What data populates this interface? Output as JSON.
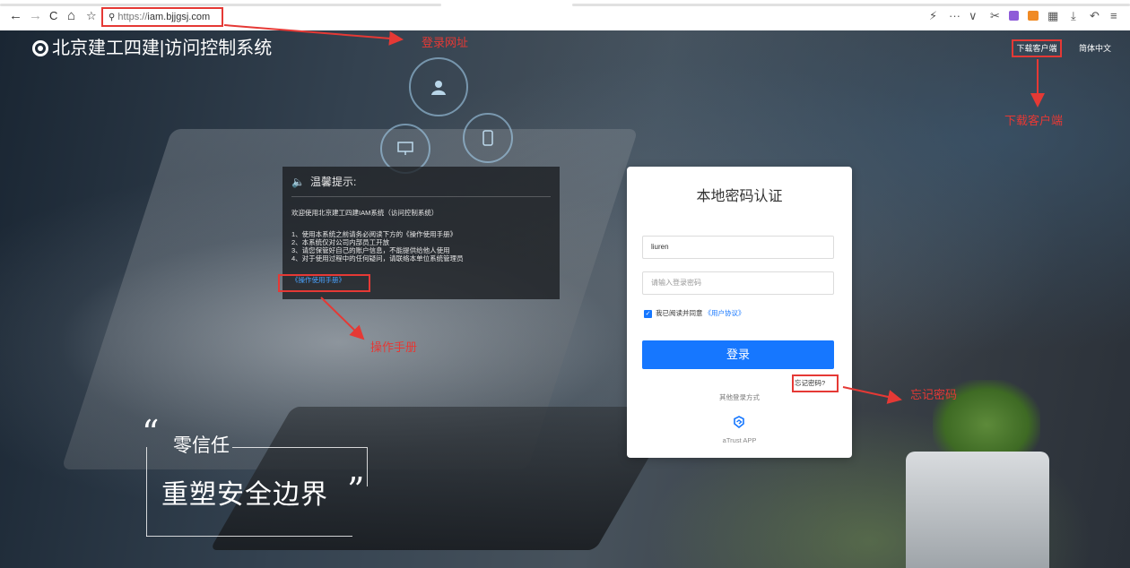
{
  "browser": {
    "nav": {
      "back": "←",
      "forward": "→",
      "reload": "C",
      "home": "⌂",
      "fav": "☆"
    },
    "address_prefix": "https://",
    "address_host": "iam.bjjgsj.com",
    "toolbar_glyphs": {
      "lightning": "⚡",
      "more": "···",
      "chevron": "∨",
      "scissors": "✂",
      "grid": "▦",
      "download": "⤓",
      "undo": "↶",
      "menu": "≡"
    }
  },
  "header": {
    "brand": "北京建工四建|访问控制系统",
    "download_client": "下载客户端",
    "language": "简体中文"
  },
  "notice": {
    "title": "温馨提示:",
    "welcome": "欢迎使用北京建工四建IAM系统（访问控制系统）",
    "items": [
      "1、使用本系统之前请务必阅读下方的《操作使用手册》",
      "2、本系统仅对公司内部员工开放",
      "3、请您保管好自己的账户信息，不能提供给他人使用",
      "4、对于使用过程中的任何疑问，请联络本单位系统管理员"
    ],
    "manual_link": "《操作使用手册》"
  },
  "login": {
    "title": "本地密码认证",
    "username_value": "liuren",
    "password_placeholder": "请输入登录密码",
    "agree_text": "我已阅读并同意",
    "agreement_link": "《用户协议》",
    "submit": "登录",
    "forgot": "忘记密码?",
    "other_methods": "其他登录方式",
    "atrust": "aTrust APP"
  },
  "slogan": {
    "line1": "零信任",
    "line2": "重塑安全边界",
    "open_quote": "“",
    "close_quote": "”"
  },
  "annotations": {
    "login_url": "登录网址",
    "download_client": "下载客户端",
    "manual": "操作手册",
    "forgot_password": "忘记密码"
  },
  "colors": {
    "primary": "#1677ff",
    "annotation": "#e53935",
    "link": "#4aa3ff"
  }
}
